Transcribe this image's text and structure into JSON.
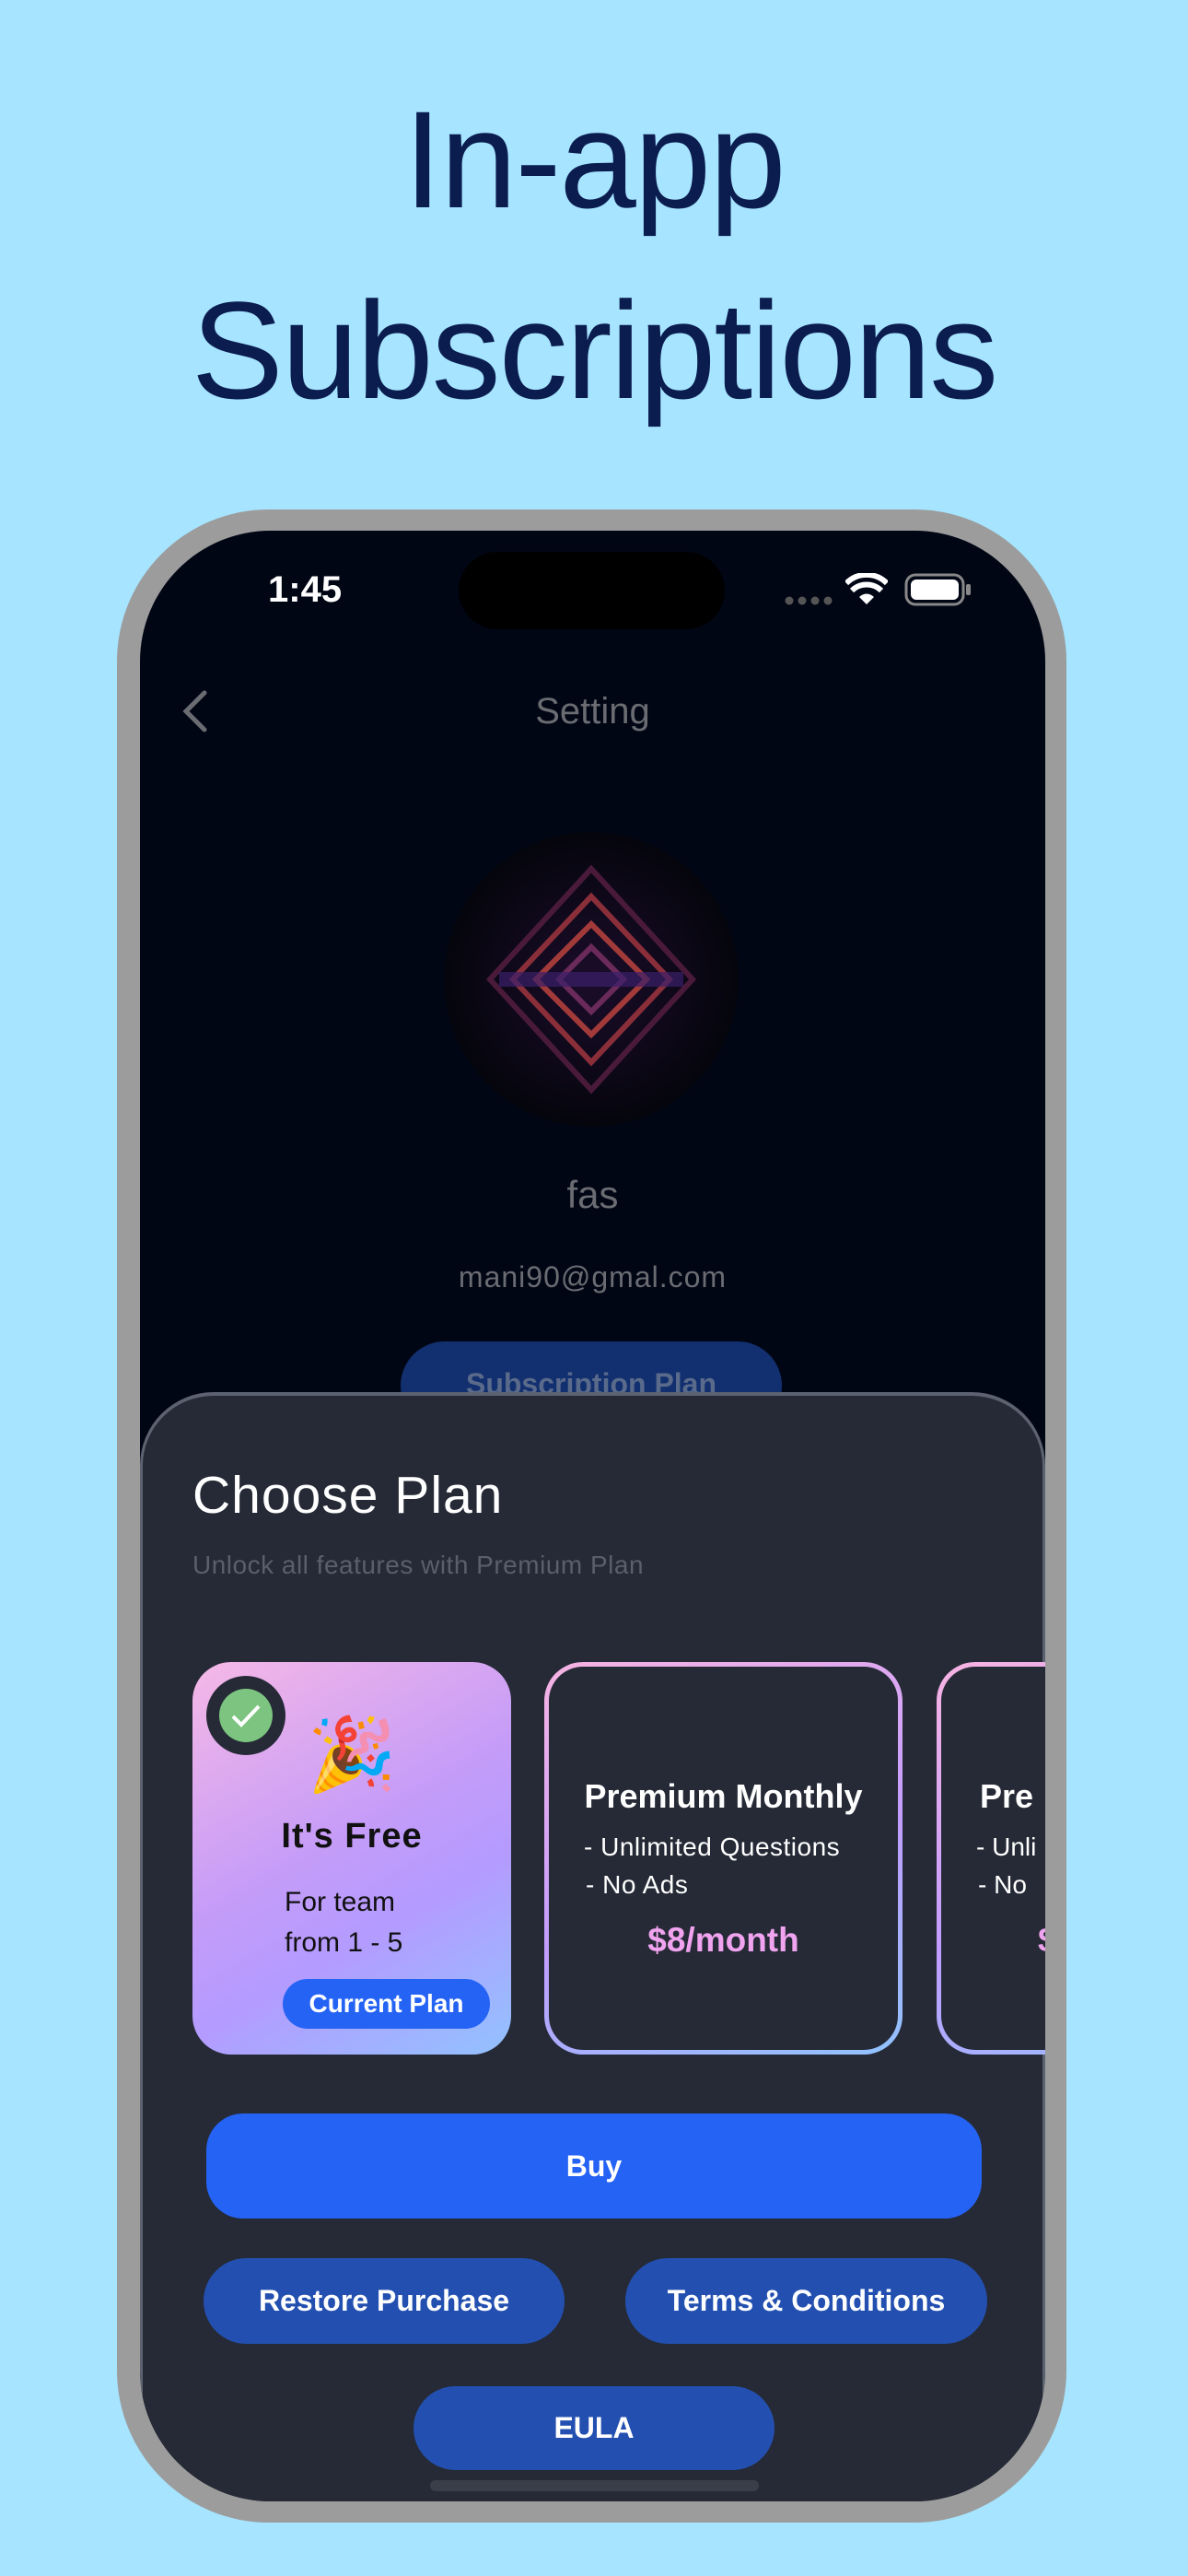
{
  "headline": {
    "line1": "In-app",
    "line2": "Subscriptions"
  },
  "status_bar": {
    "time": "1:45",
    "icons": [
      "cellular-dots-icon",
      "wifi-icon",
      "battery-icon"
    ]
  },
  "nav": {
    "title": "Setting",
    "back_icon": "chevron-left-icon"
  },
  "profile": {
    "name": "fas",
    "email": "mani90@gmal.com",
    "subscription_button": "Subscription Plan"
  },
  "sheet": {
    "title": "Choose Plan",
    "subtitle": "Unlock all features with Premium Plan",
    "plans": [
      {
        "emoji": "🎉",
        "title": "It's Free",
        "line1": "For team",
        "line2": "from 1 - 5",
        "badge": "Current Plan",
        "selected": true
      },
      {
        "title": "Premium Monthly",
        "features": [
          "- Unlimited Questions",
          "- No Ads"
        ],
        "price": "$8/month"
      },
      {
        "title": "Pre",
        "features": [
          "- Unli",
          "- No"
        ],
        "price": "$"
      }
    ],
    "buy": "Buy",
    "restore": "Restore Purchase",
    "terms": "Terms & Conditions",
    "eula": "EULA"
  },
  "colors": {
    "background": "#a6e4ff",
    "headline": "#0b1d4f",
    "primary": "#2563f5",
    "secondary": "#2350b0",
    "price": "#f0a3ee",
    "sheet": "#252a36",
    "check": "#7cc47f"
  }
}
